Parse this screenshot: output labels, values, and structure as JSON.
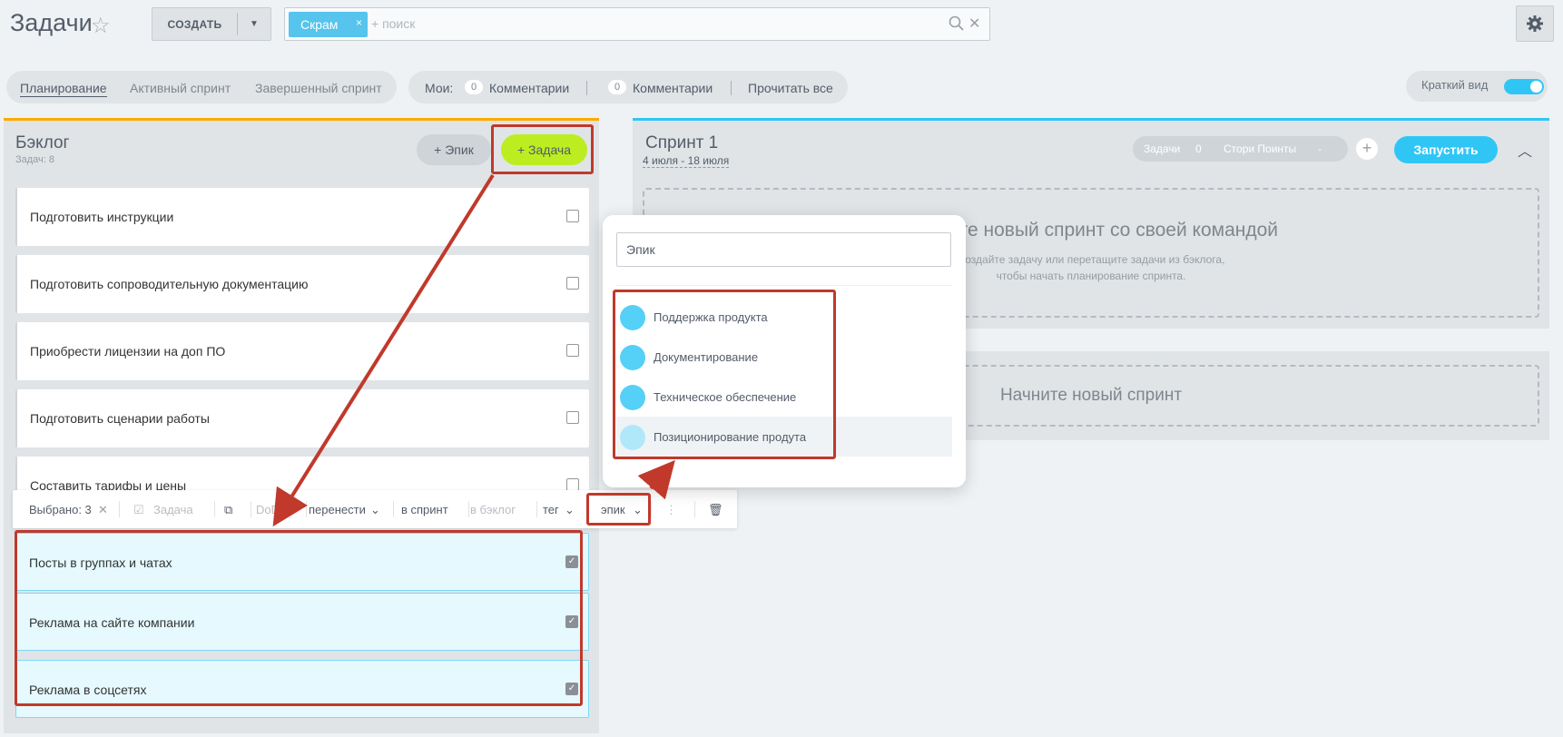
{
  "header": {
    "title": "Задачи",
    "create_label": "СОЗДАТЬ",
    "search_chip": "Скрам",
    "search_placeholder": "+ поиск"
  },
  "tabs": [
    {
      "label": "Планирование",
      "active": true
    },
    {
      "label": "Активный спринт",
      "active": false
    },
    {
      "label": "Завершенный спринт",
      "active": false
    }
  ],
  "comments": {
    "mine_label": "Мои:",
    "mine_count": "0",
    "mine_text": "Комментарии",
    "other_count": "0",
    "other_text": "Комментарии",
    "read_all": "Прочитать все"
  },
  "short_view": {
    "label": "Краткий вид",
    "on": true
  },
  "backlog": {
    "title": "Бэклог",
    "count_text": "Задач: 8",
    "epic_button": "+ Эпик",
    "task_button": "+ Задача",
    "items": [
      {
        "text": "Подготовить инструкции",
        "selected": false
      },
      {
        "text": "Подготовить сопроводительную документацию",
        "selected": false
      },
      {
        "text": "Приобрести лицензии на доп ПО",
        "selected": false
      },
      {
        "text": "Подготовить сценарии работы",
        "selected": false
      },
      {
        "text": "Составить тарифы и цены",
        "selected": false
      },
      {
        "text": "Посты в группах и чатах",
        "selected": true
      },
      {
        "text": "Реклама на сайте компании",
        "selected": true
      },
      {
        "text": "Реклама в соцсетях",
        "selected": true
      }
    ]
  },
  "selection_bar": {
    "selected": "Выбрано: 3",
    "task": "Задача",
    "dod": "DoD",
    "move": "перенести",
    "to_sprint": "в спринт",
    "to_backlog": "в бэклог",
    "tag": "тег",
    "epic": "эпик"
  },
  "sprint": {
    "title": "Спринт 1",
    "dates": "4 июля - 18 июля",
    "stats_tasks_label": "Задачи",
    "stats_tasks_count": "0",
    "stats_points_label": "Стори Поинты",
    "stats_points_value": "-",
    "start_button": "Запустить",
    "empty_heading": "Начните новый спринт со своей командой",
    "empty_line1": "Создайте задачу или перетащите задачи из бэклога,",
    "empty_line2": "чтобы начать планирование спринта."
  },
  "new_sprint": {
    "label": "Начните новый спринт"
  },
  "epic_popup": {
    "input_value": "Эпик",
    "epics": [
      {
        "name": "Поддержка продукта"
      },
      {
        "name": "Документирование"
      },
      {
        "name": "Техническое обеспечение"
      },
      {
        "name": "Позиционирование продута"
      }
    ]
  },
  "colors": {
    "accent_blue": "#2fc6f6",
    "task_green": "#bbed21",
    "backlog_orange": "#ffa900",
    "annotation_red": "#c0392b"
  }
}
